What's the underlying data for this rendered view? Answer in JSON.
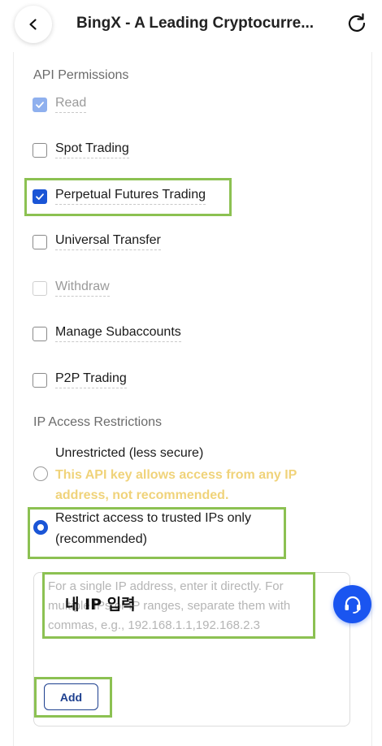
{
  "header": {
    "title": "BingX - A Leading Cryptocurre..."
  },
  "api_permissions": {
    "section_title": "API Permissions",
    "items": [
      {
        "label": "Read",
        "checked": true,
        "disabled": true
      },
      {
        "label": "Spot Trading",
        "checked": false,
        "disabled": false
      },
      {
        "label": "Perpetual Futures Trading",
        "checked": true,
        "disabled": false
      },
      {
        "label": "Universal Transfer",
        "checked": false,
        "disabled": false
      },
      {
        "label": "Withdraw",
        "checked": false,
        "disabled": true
      },
      {
        "label": "Manage Subaccounts",
        "checked": false,
        "disabled": false
      },
      {
        "label": "P2P Trading",
        "checked": false,
        "disabled": false
      }
    ]
  },
  "ip_restrictions": {
    "section_title": "IP Access Restrictions",
    "unrestricted_label": "Unrestricted (less secure)",
    "unrestricted_warning_1": "This API key allows access from any IP",
    "unrestricted_warning_2": "address, not recommended.",
    "restrict_label_1": "Restrict access to trusted IPs only",
    "restrict_label_2": "(recommended)",
    "selected": "restrict",
    "ip_placeholder": "For a single IP address, enter it directly. For multiple IPs or IP ranges, separate them with commas, e.g., 192.168.1.1,192.168.2.3",
    "overlay_annotation": "내 IP 입력",
    "add_label": "Add"
  },
  "colors": {
    "accent": "#1a55d6",
    "annotation_box": "#8cc152",
    "warning_text": "#f0d37a"
  }
}
